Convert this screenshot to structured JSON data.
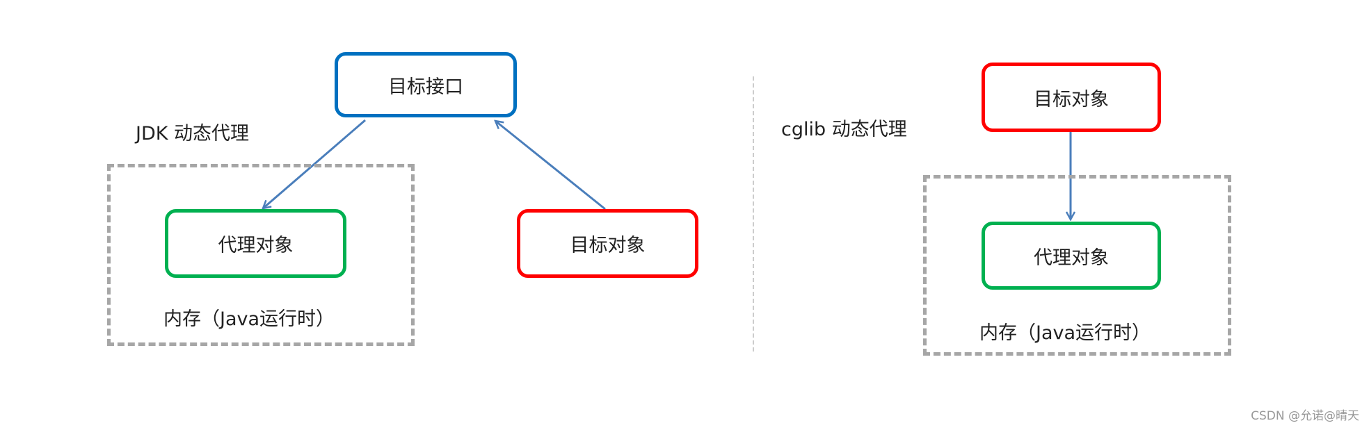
{
  "jdk": {
    "title": "JDK 动态代理",
    "target_interface": "目标接口",
    "proxy_object": "代理对象",
    "target_object": "目标对象",
    "memory_label": "内存（Java运行时）"
  },
  "cglib": {
    "title": "cglib 动态代理",
    "target_object": "目标对象",
    "proxy_object": "代理对象",
    "memory_label": "内存（Java运行时）"
  },
  "watermark": "CSDN @允诺@晴天",
  "colors": {
    "interface": "#0070c0",
    "target": "#ff0000",
    "proxy": "#00b050",
    "arrow": "#4a7ebb",
    "dashed": "#a6a6a6"
  }
}
